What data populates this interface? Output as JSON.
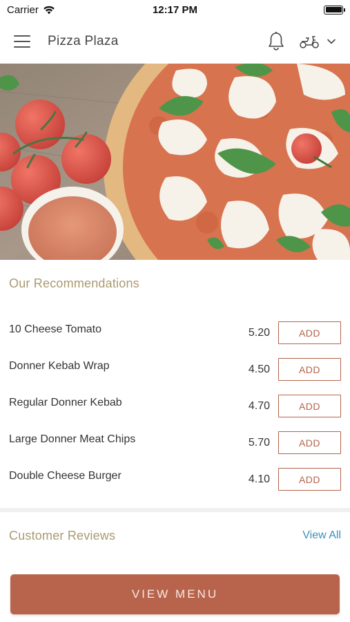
{
  "status_bar": {
    "carrier": "Carrier",
    "time": "12:17 PM"
  },
  "header": {
    "title": "Pizza Plaza",
    "icons": [
      "hamburger-menu-icon",
      "bell-icon",
      "scooter-icon",
      "chevron-down-icon"
    ]
  },
  "recommendations": {
    "title": "Our Recommendations",
    "items": [
      {
        "name": "10 Cheese Tomato",
        "price": "5.20",
        "button": "ADD"
      },
      {
        "name": "Donner Kebab Wrap",
        "price": "4.50",
        "button": "ADD"
      },
      {
        "name": "Regular Donner Kebab",
        "price": "4.70",
        "button": "ADD"
      },
      {
        "name": "Large Donner Meat Chips",
        "price": "5.70",
        "button": "ADD"
      },
      {
        "name": "Double Cheese Burger",
        "price": "4.10",
        "button": "ADD"
      }
    ]
  },
  "reviews": {
    "title": "Customer Reviews",
    "view_all": "View All"
  },
  "cta": {
    "label": "VIEW MENU"
  },
  "colors": {
    "accent": "#b8644c",
    "section_title": "#ab9a72",
    "link": "#3a8fbd"
  }
}
